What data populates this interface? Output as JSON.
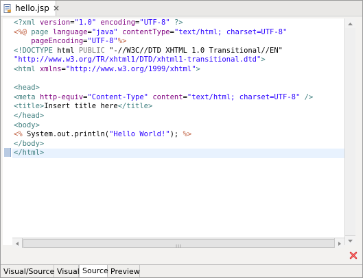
{
  "editor_tab": {
    "title": "hello.jsp",
    "file_icon": "jsp-file-icon",
    "close_icon": "close-icon"
  },
  "code_lines": [
    [
      {
        "c": "t-pi",
        "t": "<?xml "
      },
      {
        "c": "t-attr",
        "t": "version"
      },
      {
        "c": "t-text",
        "t": "="
      },
      {
        "c": "t-val",
        "t": "\"1.0\""
      },
      {
        "c": "t-text",
        "t": " "
      },
      {
        "c": "t-attr",
        "t": "encoding"
      },
      {
        "c": "t-text",
        "t": "="
      },
      {
        "c": "t-val",
        "t": "\"UTF-8\""
      },
      {
        "c": "t-text",
        "t": " "
      },
      {
        "c": "t-pi",
        "t": "?>"
      }
    ],
    [
      {
        "c": "t-jsp",
        "t": "<%@ "
      },
      {
        "c": "t-tag",
        "t": "page"
      },
      {
        "c": "t-text",
        "t": " "
      },
      {
        "c": "t-attr",
        "t": "language"
      },
      {
        "c": "t-text",
        "t": "="
      },
      {
        "c": "t-val",
        "t": "\"java\""
      },
      {
        "c": "t-text",
        "t": " "
      },
      {
        "c": "t-attr",
        "t": "contentType"
      },
      {
        "c": "t-text",
        "t": "="
      },
      {
        "c": "t-val",
        "t": "\"text/html; charset=UTF-8\""
      }
    ],
    [
      {
        "c": "t-text",
        "t": "    "
      },
      {
        "c": "t-attr",
        "t": "pageEncoding"
      },
      {
        "c": "t-text",
        "t": "="
      },
      {
        "c": "t-val",
        "t": "\"UTF-8\""
      },
      {
        "c": "t-jsp",
        "t": "%>"
      }
    ],
    [
      {
        "c": "t-tag",
        "t": "<!DOCTYPE "
      },
      {
        "c": "t-doctype",
        "t": "html"
      },
      {
        "c": "t-text",
        "t": " "
      },
      {
        "c": "t-kw",
        "t": "PUBLIC"
      },
      {
        "c": "t-text",
        "t": " "
      },
      {
        "c": "t-doctype",
        "t": "\"-//W3C//DTD XHTML 1.0 Transitional//EN\""
      }
    ],
    [
      {
        "c": "t-val",
        "t": "\"http://www.w3.org/TR/xhtml1/DTD/xhtml1-transitional.dtd\""
      },
      {
        "c": "t-tag",
        "t": ">"
      }
    ],
    [
      {
        "c": "t-tag",
        "t": "<html "
      },
      {
        "c": "t-attr",
        "t": "xmlns"
      },
      {
        "c": "t-text",
        "t": "="
      },
      {
        "c": "t-val",
        "t": "\"http://www.w3.org/1999/xhtml\""
      },
      {
        "c": "t-tag",
        "t": ">"
      }
    ],
    [
      {
        "c": "t-text",
        "t": ""
      }
    ],
    [
      {
        "c": "t-tag",
        "t": "<head>"
      }
    ],
    [
      {
        "c": "t-tag",
        "t": "<meta "
      },
      {
        "c": "t-attr",
        "t": "http-equiv"
      },
      {
        "c": "t-text",
        "t": "="
      },
      {
        "c": "t-val",
        "t": "\"Content-Type\""
      },
      {
        "c": "t-text",
        "t": " "
      },
      {
        "c": "t-attr",
        "t": "content"
      },
      {
        "c": "t-text",
        "t": "="
      },
      {
        "c": "t-val",
        "t": "\"text/html; charset=UTF-8\""
      },
      {
        "c": "t-text",
        "t": " "
      },
      {
        "c": "t-tag",
        "t": "/>"
      }
    ],
    [
      {
        "c": "t-tag",
        "t": "<title>"
      },
      {
        "c": "t-text",
        "t": "Insert title here"
      },
      {
        "c": "t-tag",
        "t": "</title>"
      }
    ],
    [
      {
        "c": "t-tag",
        "t": "</head>"
      }
    ],
    [
      {
        "c": "t-tag",
        "t": "<body>"
      }
    ],
    [
      {
        "c": "t-jsp",
        "t": "<%"
      },
      {
        "c": "t-text",
        "t": " System.out.println("
      },
      {
        "c": "t-val",
        "t": "\"Hello World!\""
      },
      {
        "c": "t-text",
        "t": "); "
      },
      {
        "c": "t-jsp",
        "t": "%>"
      }
    ],
    [
      {
        "c": "t-tag",
        "t": "</body>"
      }
    ],
    [
      {
        "c": "t-tag",
        "t": "</html>"
      }
    ]
  ],
  "current_line": 14,
  "bottom_tabs": [
    {
      "label": "Visual/Source",
      "active": false
    },
    {
      "label": "Visual",
      "active": false
    },
    {
      "label": "Source",
      "active": true
    },
    {
      "label": "Preview",
      "active": false
    }
  ],
  "colors": {
    "tag": "#3f7f7f",
    "attribute": "#7f007f",
    "value": "#2a00ff",
    "jsp_delimiter": "#bf5f3f",
    "current_line": "#e8f2fe",
    "close_red": "#d42a2a"
  }
}
